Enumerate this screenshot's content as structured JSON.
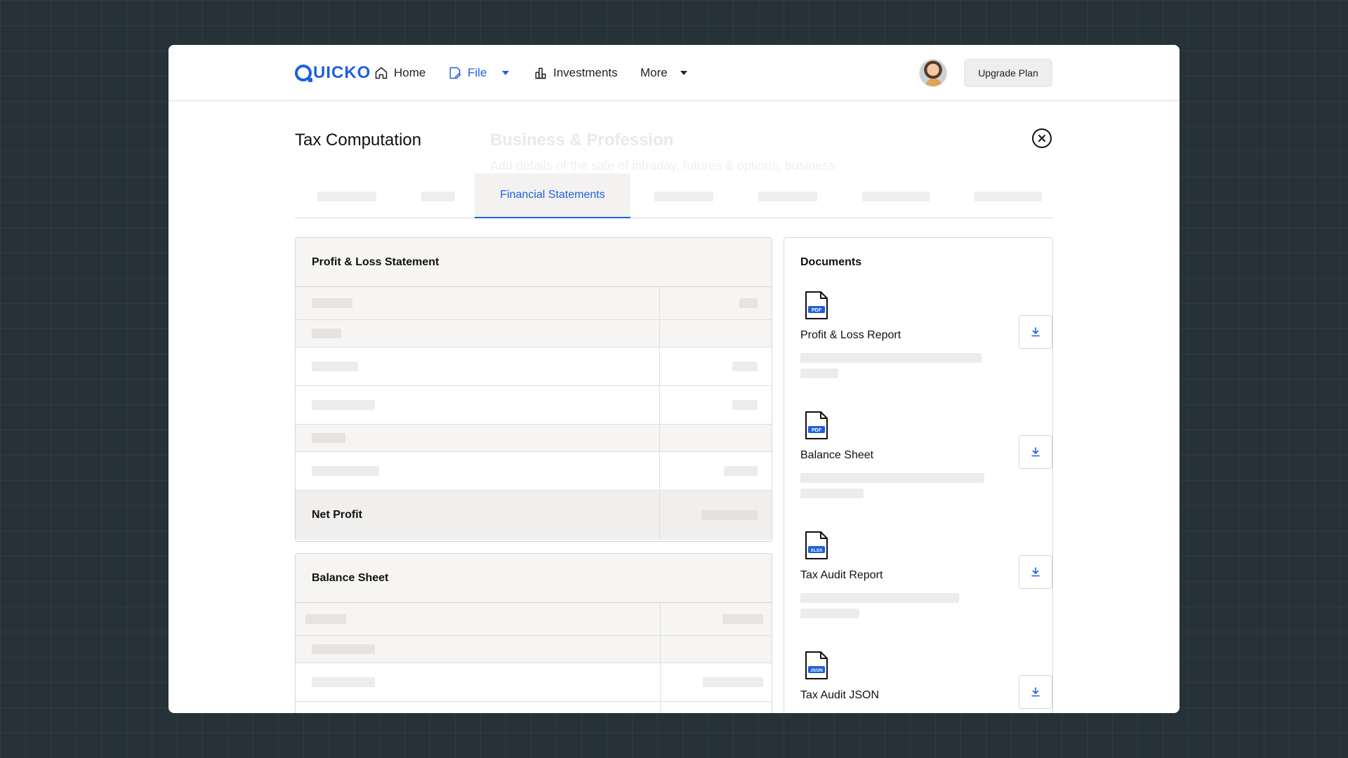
{
  "app": {
    "brand": "UICKO",
    "brand_color": "#1f5fe0"
  },
  "nav": {
    "home": "Home",
    "file": "File",
    "investments": "Investments",
    "more": "More",
    "upgrade": "Upgrade Plan"
  },
  "modal": {
    "title": "Tax Computation",
    "bg_title": "Business & Profession",
    "bg_subtitle": "Add details of the sale of intraday, futures & options, business",
    "active_tab": "Financial Statements"
  },
  "pnl": {
    "title": "Profit & Loss Statement",
    "net_profit_label": "Net Profit"
  },
  "balance_sheet": {
    "title": "Balance Sheet"
  },
  "documents": {
    "title": "Documents",
    "items": [
      {
        "name": "Profit & Loss Report",
        "type": "PDF"
      },
      {
        "name": "Balance Sheet",
        "type": "PDF"
      },
      {
        "name": "Tax Audit Report",
        "type": "XLSX"
      },
      {
        "name": "Tax Audit JSON",
        "type": "JSON"
      }
    ]
  },
  "icons": {
    "home": "home-icon",
    "file": "file-edit-icon",
    "investments": "bar-chart-icon",
    "close": "close-circle-icon",
    "download": "download-icon"
  }
}
